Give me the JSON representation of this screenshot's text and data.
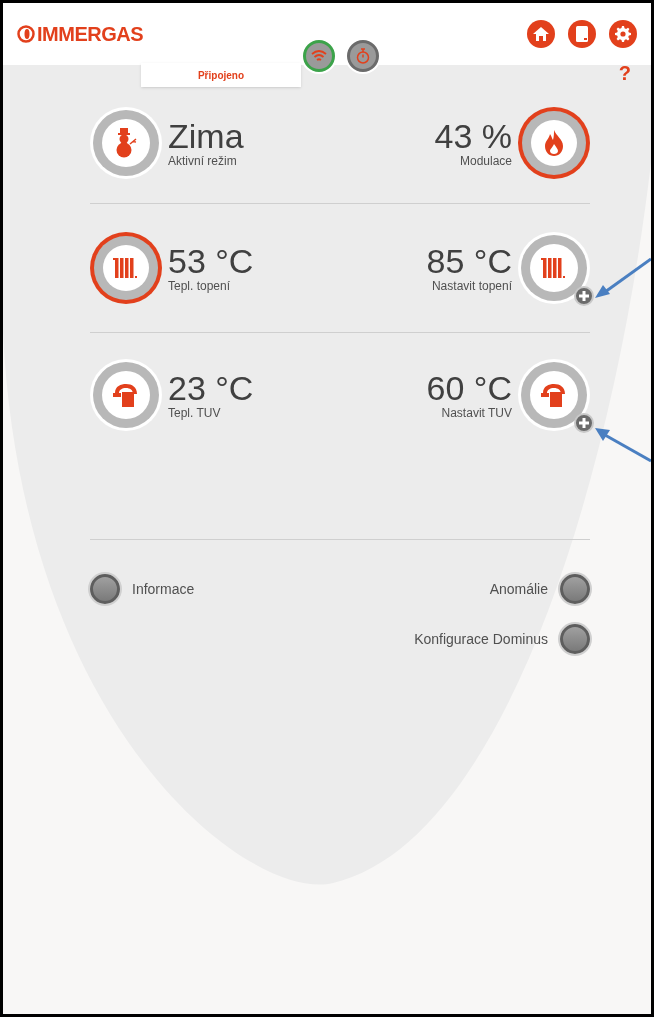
{
  "header": {
    "logo": "IMMERGAS",
    "status_tab": "Připojeno",
    "wifi_connected": true
  },
  "help": "?",
  "gauge_rows": [
    {
      "left": {
        "kind": "season",
        "value": "Zima",
        "label": "Aktivní režim",
        "highlighted": false,
        "adjustable": false
      },
      "right": {
        "kind": "flame",
        "value": "43 %",
        "label": "Modulace",
        "highlighted": true,
        "adjustable": false
      }
    },
    {
      "left": {
        "kind": "radiator",
        "value": "53 °C",
        "label": "Tepl. topení",
        "highlighted": true,
        "adjustable": false
      },
      "right": {
        "kind": "radiator",
        "value": "85 °C",
        "label": "Nastavit topení",
        "highlighted": false,
        "adjustable": true
      }
    },
    {
      "left": {
        "kind": "tap",
        "value": "23 °C",
        "label": "Tepl. TUV",
        "highlighted": false,
        "adjustable": false
      },
      "right": {
        "kind": "tap",
        "value": "60 °C",
        "label": "Nastavit TUV",
        "highlighted": false,
        "adjustable": true
      }
    }
  ],
  "left_links": [
    "Informace"
  ],
  "right_links": [
    "Anomálie",
    "Konfigurace Dominus"
  ]
}
